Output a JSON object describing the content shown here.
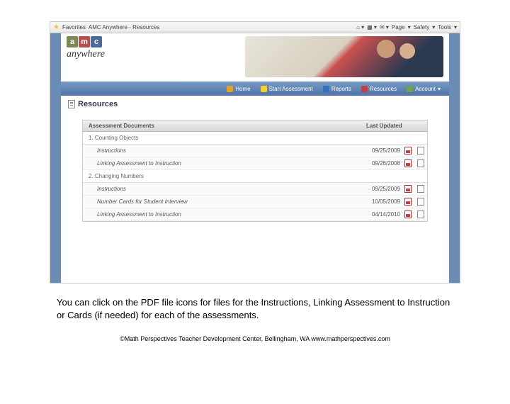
{
  "browser": {
    "favorites_label": "Favorites",
    "tab_title": "AMC Anywhere - Resources",
    "tools": {
      "page": "Page",
      "safety": "Safety",
      "tools": "Tools"
    }
  },
  "logo": {
    "a": "a",
    "m": "m",
    "c": "c",
    "script": "anywhere"
  },
  "nav": {
    "home": "Home",
    "start": "Start Assessment",
    "reports": "Reports",
    "resources": "Resources",
    "account": "Account"
  },
  "section_title": "Resources",
  "table": {
    "col_docs": "Assessment Documents",
    "col_updated": "Last Updated",
    "groups": [
      {
        "title": "1. Counting Objects",
        "rows": [
          {
            "label": "Instructions",
            "date": "09/25/2009"
          },
          {
            "label": "Linking Assessment to Instruction",
            "date": "09/26/2008"
          }
        ]
      },
      {
        "title": "2. Changing Numbers",
        "rows": [
          {
            "label": "Instructions",
            "date": "09/25/2009"
          },
          {
            "label": "Number Cards for Student Interview",
            "date": "10/05/2009"
          },
          {
            "label": "Linking Assessment to Instruction",
            "date": "04/14/2010"
          }
        ]
      }
    ]
  },
  "caption": "You can click on the PDF file icons for files for the Instructions, Linking Assessment to Instruction or Cards (if needed) for each of the assessments.",
  "footer": "©Math Perspectives Teacher Development Center, Bellingham, WA www.mathperspectives.com"
}
